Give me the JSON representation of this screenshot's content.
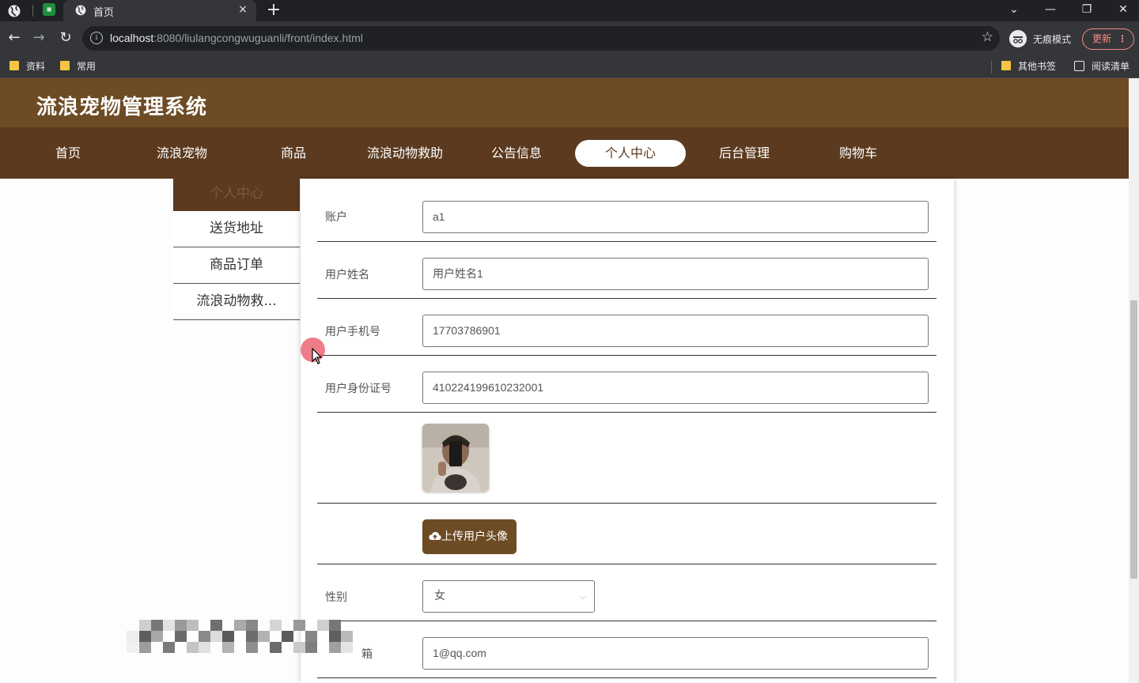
{
  "browser": {
    "tab_title": "首页",
    "tab_close": "×",
    "new_tab": "+",
    "url_host": "localhost",
    "url_rest": ":8080/liulangcongwuguanli/front/index.html",
    "profile_label": "无痕模式",
    "update_label": "更新",
    "bookmarks": [
      "资料",
      "常用"
    ],
    "other_bookmarks": "其他书签",
    "reading_list": "阅读清单"
  },
  "site": {
    "title": "流浪宠物管理系统",
    "nav": [
      "首页",
      "流浪宠物",
      "商品",
      "流浪动物救助",
      "公告信息",
      "个人中心",
      "后台管理",
      "购物车"
    ],
    "active_nav": "个人中心"
  },
  "side_menu": {
    "items": [
      "个人中心",
      "送货地址",
      "商品订单",
      "流浪动物救..."
    ]
  },
  "form": {
    "account_label": "账户",
    "account_value": "a1",
    "name_label": "用户姓名",
    "name_value": "用户姓名1",
    "phone_label": "用户手机号",
    "phone_value": "17703786901",
    "idcard_label": "用户身份证号",
    "idcard_value": "410224199610232001",
    "upload_label": "上传用户头像",
    "gender_label": "性别",
    "gender_value": "女",
    "email_label_partial": "箱",
    "email_value": "1@qq.com"
  },
  "colors": {
    "header_brown": "#6d4b24",
    "nav_brown": "#5b3a1f"
  }
}
